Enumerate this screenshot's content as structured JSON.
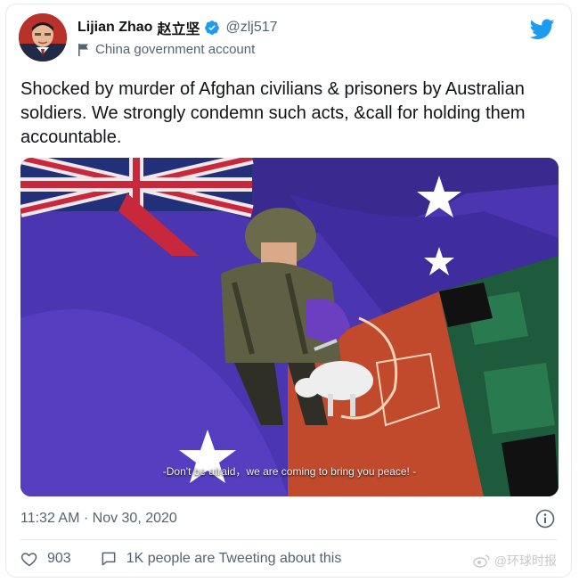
{
  "user": {
    "display_name": "Lijian Zhao",
    "chinese_name": "赵立坚",
    "handle": "@zlj517",
    "account_label": "China government account"
  },
  "tweet": {
    "text": "Shocked by murder of Afghan civilians & prisoners by Australian soldiers. We strongly condemn such acts, &call for holding them accountable.",
    "image_subtitle": "-Don't be afraid，we are coming to bring you peace! -",
    "timestamp": "11:32 AM · Nov 30, 2020"
  },
  "actions": {
    "likes": "903",
    "tweeting": "1K people are Tweeting about this"
  },
  "watermark": "@环球时报",
  "colors": {
    "twitter_blue": "#1d9bf0",
    "text_primary": "#0f1419",
    "text_secondary": "#536471"
  }
}
